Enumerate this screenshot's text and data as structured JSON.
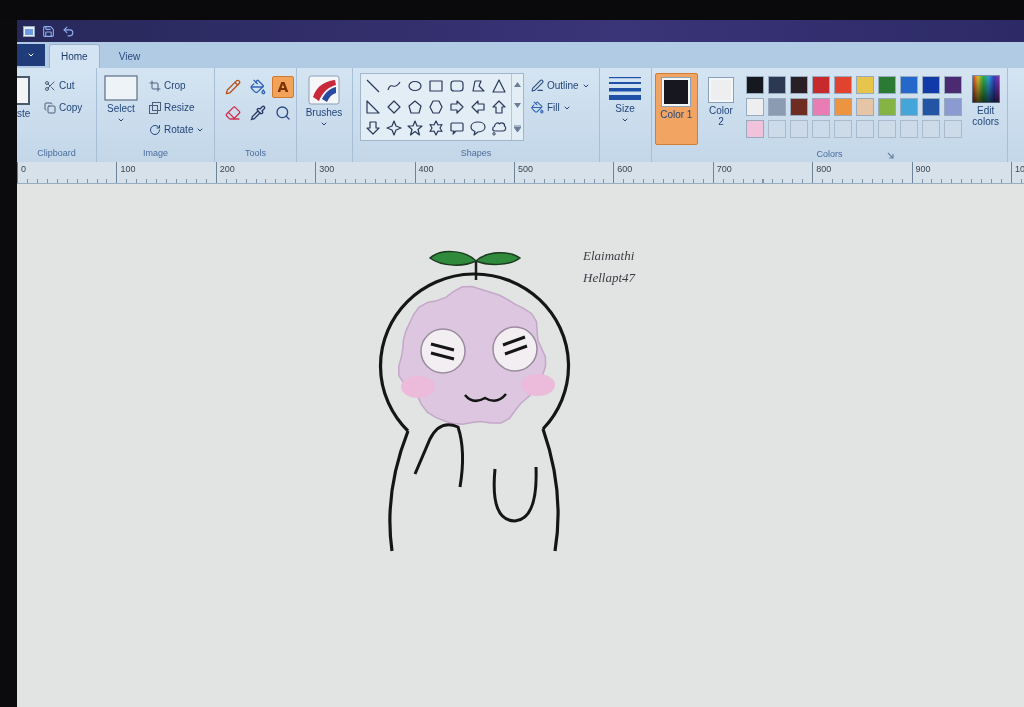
{
  "tabs": [
    {
      "label": "Home",
      "selected": true
    },
    {
      "label": "View",
      "selected": false
    }
  ],
  "clipboard": {
    "paste": "ste",
    "cut": "Cut",
    "copy": "Copy",
    "label": "Clipboard"
  },
  "image": {
    "select": "Select",
    "crop": "Crop",
    "resize": "Resize",
    "rotate": "Rotate",
    "label": "Image"
  },
  "tools": {
    "items": [
      {
        "kind": "pencil",
        "selected": false
      },
      {
        "kind": "fill",
        "selected": false
      },
      {
        "kind": "text",
        "glyph": "A",
        "selected": true
      },
      {
        "kind": "eraser",
        "selected": false
      },
      {
        "kind": "picker",
        "selected": false
      },
      {
        "kind": "magnifier",
        "selected": false
      }
    ],
    "brushes": "Brushes",
    "label": "Tools"
  },
  "shapes": {
    "outline": "Outline",
    "fill": "Fill",
    "label": "Shapes"
  },
  "size": {
    "label": "Size"
  },
  "colors": {
    "color_1": {
      "label": "Color 1",
      "color": "#17181f",
      "selected": true
    },
    "color_2": {
      "label": "Color 2",
      "color": "#eeeef0",
      "selected": false
    },
    "palette": [
      {
        "kind": "color",
        "color": "#16181f"
      },
      {
        "kind": "color",
        "color": "#2c3852"
      },
      {
        "kind": "color",
        "color": "#2a1f24"
      },
      {
        "kind": "color",
        "color": "#c62a2c"
      },
      {
        "kind": "color",
        "color": "#e2432e"
      },
      {
        "kind": "color",
        "color": "#e6c54a"
      },
      {
        "kind": "color",
        "color": "#2a7a34"
      },
      {
        "kind": "color",
        "color": "#2568cc"
      },
      {
        "kind": "color",
        "color": "#0f3aa8"
      },
      {
        "kind": "color",
        "color": "#4b2a72"
      },
      {
        "kind": "color",
        "color": "#eeeef0"
      },
      {
        "kind": "color",
        "color": "#8c9ab2"
      },
      {
        "kind": "color",
        "color": "#6e2c22"
      },
      {
        "kind": "color",
        "color": "#ea7cb4"
      },
      {
        "kind": "color",
        "color": "#ec9440"
      },
      {
        "kind": "color",
        "color": "#e6c4a6"
      },
      {
        "kind": "color",
        "color": "#86b444"
      },
      {
        "kind": "color",
        "color": "#44a6d8"
      },
      {
        "kind": "color",
        "color": "#2454a4"
      },
      {
        "kind": "color",
        "color": "#8c9ad2"
      },
      {
        "kind": "color",
        "color": "#f2c2da"
      },
      {
        "kind": "empty"
      },
      {
        "kind": "empty"
      },
      {
        "kind": "empty"
      },
      {
        "kind": "empty"
      },
      {
        "kind": "empty"
      },
      {
        "kind": "empty"
      },
      {
        "kind": "empty"
      },
      {
        "kind": "empty"
      },
      {
        "kind": "empty"
      }
    ],
    "edit": "Edit colors",
    "label": "Colors"
  },
  "ruler": {
    "ticks": [
      "0",
      "100",
      "200",
      "300",
      "400",
      "500",
      "600",
      "700",
      "800",
      "900",
      "10"
    ]
  },
  "canvas": {
    "signature": [
      "Elaimathi",
      "Hellapt47"
    ]
  }
}
